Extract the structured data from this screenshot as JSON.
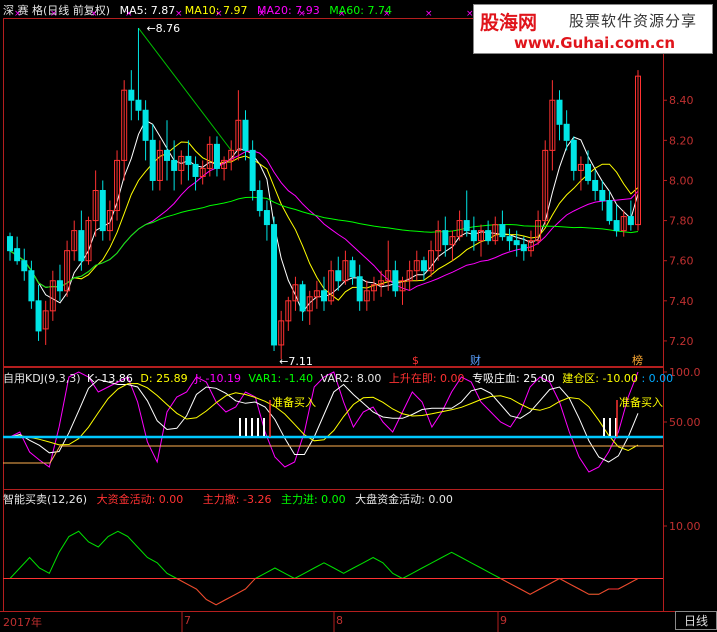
{
  "main_header": {
    "stock": "深 赛 格(日线 前复权)",
    "ma5": "MA5: 7.87",
    "ma10": "MA10: 7.97",
    "ma20": "MA20: 7.93",
    "ma60": "MA60: 7.74"
  },
  "logo": {
    "main": "股海网",
    "sub": "股票软件资源分享",
    "url": "www.Guhai.com.cn"
  },
  "price_annotations": {
    "high": "8.76",
    "low": "7.11"
  },
  "event_markers": [
    "$",
    "财",
    "榜"
  ],
  "kdj_header": {
    "name": "自用KDJ(9,3,3)",
    "k": "K: 13.86",
    "d": "D: 25.89",
    "j": "J: -10.19",
    "var1": "VAR1: -1.40",
    "var2": "VAR2: 8.00",
    "rise": "上升在即: 0.00",
    "absorb": "专吸庄血: 25.00",
    "build": "建仓区: -10.00",
    "extra": ": 0.00"
  },
  "kdj_signals": [
    "准备买入",
    "准备买入"
  ],
  "smart_header": {
    "name": "智能买卖(12,26)",
    "big_money": "大资金活动: 0.00",
    "main_sell": "主力撤: -3.26",
    "main_buy": "主力进: 0.00",
    "market": "大盘资金活动: 0.00"
  },
  "axes": {
    "main_y": [
      "8.40",
      "8.20",
      "8.00",
      "7.80",
      "7.60",
      "7.40",
      "7.20"
    ],
    "kdj_y": [
      "100.0",
      "50.00"
    ],
    "smart_y": [
      "10.00"
    ],
    "x": [
      "2017年",
      "7",
      "8",
      "9"
    ]
  },
  "period_button": "日线",
  "colors": {
    "up": "#ff3232",
    "down": "#00e5e5",
    "ma5": "#ffffff",
    "ma10": "#ffff00",
    "ma20": "#ff00ff",
    "ma60": "#00ff00",
    "frame": "#b41e1e"
  },
  "chart_data": {
    "type": "candlestick",
    "ylim": [
      7.08,
      8.8
    ],
    "candles": [
      [
        7.72,
        7.74,
        7.6,
        7.65
      ],
      [
        7.66,
        7.72,
        7.58,
        7.6
      ],
      [
        7.6,
        7.66,
        7.5,
        7.55
      ],
      [
        7.55,
        7.6,
        7.36,
        7.4
      ],
      [
        7.4,
        7.48,
        7.2,
        7.25
      ],
      [
        7.26,
        7.4,
        7.18,
        7.35
      ],
      [
        7.35,
        7.55,
        7.3,
        7.5
      ],
      [
        7.5,
        7.58,
        7.4,
        7.45
      ],
      [
        7.45,
        7.7,
        7.42,
        7.65
      ],
      [
        7.65,
        7.8,
        7.6,
        7.75
      ],
      [
        7.75,
        7.85,
        7.55,
        7.6
      ],
      [
        7.6,
        7.82,
        7.58,
        7.8
      ],
      [
        7.8,
        8.05,
        7.72,
        7.95
      ],
      [
        7.95,
        8.0,
        7.7,
        7.75
      ],
      [
        7.75,
        7.9,
        7.7,
        7.85
      ],
      [
        7.85,
        8.15,
        7.8,
        8.1
      ],
      [
        8.1,
        8.5,
        8.0,
        8.45
      ],
      [
        8.45,
        8.55,
        8.3,
        8.4
      ],
      [
        8.4,
        8.76,
        8.3,
        8.35
      ],
      [
        8.35,
        8.4,
        8.1,
        8.2
      ],
      [
        8.2,
        8.28,
        7.95,
        8.0
      ],
      [
        8.0,
        8.2,
        7.95,
        8.15
      ],
      [
        8.15,
        8.3,
        8.0,
        8.1
      ],
      [
        8.1,
        8.2,
        7.95,
        8.05
      ],
      [
        8.05,
        8.15,
        7.98,
        8.12
      ],
      [
        8.12,
        8.2,
        8.0,
        8.08
      ],
      [
        8.08,
        8.12,
        7.95,
        8.02
      ],
      [
        8.02,
        8.1,
        7.98,
        8.06
      ],
      [
        8.06,
        8.22,
        8.02,
        8.18
      ],
      [
        8.18,
        8.22,
        8.02,
        8.06
      ],
      [
        8.06,
        8.12,
        8.0,
        8.1
      ],
      [
        8.1,
        8.2,
        8.05,
        8.15
      ],
      [
        8.15,
        8.45,
        8.1,
        8.3
      ],
      [
        8.3,
        8.35,
        8.1,
        8.15
      ],
      [
        8.15,
        8.2,
        7.9,
        7.95
      ],
      [
        7.95,
        8.0,
        7.82,
        7.85
      ],
      [
        7.85,
        7.9,
        7.7,
        7.78
      ],
      [
        7.78,
        7.82,
        7.15,
        7.18
      ],
      [
        7.18,
        7.35,
        7.11,
        7.3
      ],
      [
        7.3,
        7.42,
        7.25,
        7.4
      ],
      [
        7.4,
        7.52,
        7.35,
        7.48
      ],
      [
        7.48,
        7.5,
        7.3,
        7.35
      ],
      [
        7.35,
        7.45,
        7.28,
        7.42
      ],
      [
        7.42,
        7.5,
        7.36,
        7.45
      ],
      [
        7.45,
        7.52,
        7.35,
        7.4
      ],
      [
        7.4,
        7.6,
        7.38,
        7.55
      ],
      [
        7.55,
        7.62,
        7.45,
        7.5
      ],
      [
        7.5,
        7.65,
        7.48,
        7.6
      ],
      [
        7.6,
        7.62,
        7.48,
        7.52
      ],
      [
        7.52,
        7.58,
        7.35,
        7.4
      ],
      [
        7.4,
        7.5,
        7.35,
        7.45
      ],
      [
        7.45,
        7.52,
        7.4,
        7.48
      ],
      [
        7.48,
        7.55,
        7.42,
        7.5
      ],
      [
        7.5,
        7.7,
        7.45,
        7.55
      ],
      [
        7.55,
        7.6,
        7.42,
        7.45
      ],
      [
        7.45,
        7.52,
        7.38,
        7.5
      ],
      [
        7.5,
        7.6,
        7.45,
        7.55
      ],
      [
        7.55,
        7.65,
        7.5,
        7.6
      ],
      [
        7.6,
        7.62,
        7.5,
        7.55
      ],
      [
        7.55,
        7.7,
        7.52,
        7.65
      ],
      [
        7.65,
        7.8,
        7.6,
        7.75
      ],
      [
        7.75,
        7.82,
        7.62,
        7.68
      ],
      [
        7.68,
        7.75,
        7.6,
        7.72
      ],
      [
        7.72,
        7.85,
        7.7,
        7.8
      ],
      [
        7.8,
        7.95,
        7.72,
        7.75
      ],
      [
        7.75,
        7.82,
        7.65,
        7.7
      ],
      [
        7.7,
        7.78,
        7.62,
        7.75
      ],
      [
        7.75,
        7.8,
        7.68,
        7.7
      ],
      [
        7.7,
        7.82,
        7.68,
        7.78
      ],
      [
        7.78,
        7.85,
        7.7,
        7.72
      ],
      [
        7.72,
        7.76,
        7.65,
        7.7
      ],
      [
        7.7,
        7.75,
        7.62,
        7.68
      ],
      [
        7.68,
        7.72,
        7.6,
        7.65
      ],
      [
        7.65,
        7.75,
        7.62,
        7.7
      ],
      [
        7.7,
        7.85,
        7.68,
        7.8
      ],
      [
        7.8,
        8.2,
        7.78,
        8.15
      ],
      [
        8.15,
        8.5,
        8.05,
        8.4
      ],
      [
        8.4,
        8.45,
        8.2,
        8.28
      ],
      [
        8.28,
        8.35,
        8.15,
        8.2
      ],
      [
        8.2,
        8.22,
        8.0,
        8.05
      ],
      [
        8.05,
        8.12,
        7.95,
        8.08
      ],
      [
        8.08,
        8.15,
        7.98,
        8.0
      ],
      [
        8.0,
        8.05,
        7.9,
        7.95
      ],
      [
        7.95,
        8.0,
        7.85,
        7.9
      ],
      [
        7.9,
        7.95,
        7.78,
        7.8
      ],
      [
        7.8,
        7.88,
        7.72,
        7.75
      ],
      [
        7.75,
        7.85,
        7.72,
        7.82
      ],
      [
        7.82,
        7.9,
        7.75,
        7.78
      ],
      [
        7.78,
        8.55,
        7.75,
        8.52
      ]
    ]
  }
}
